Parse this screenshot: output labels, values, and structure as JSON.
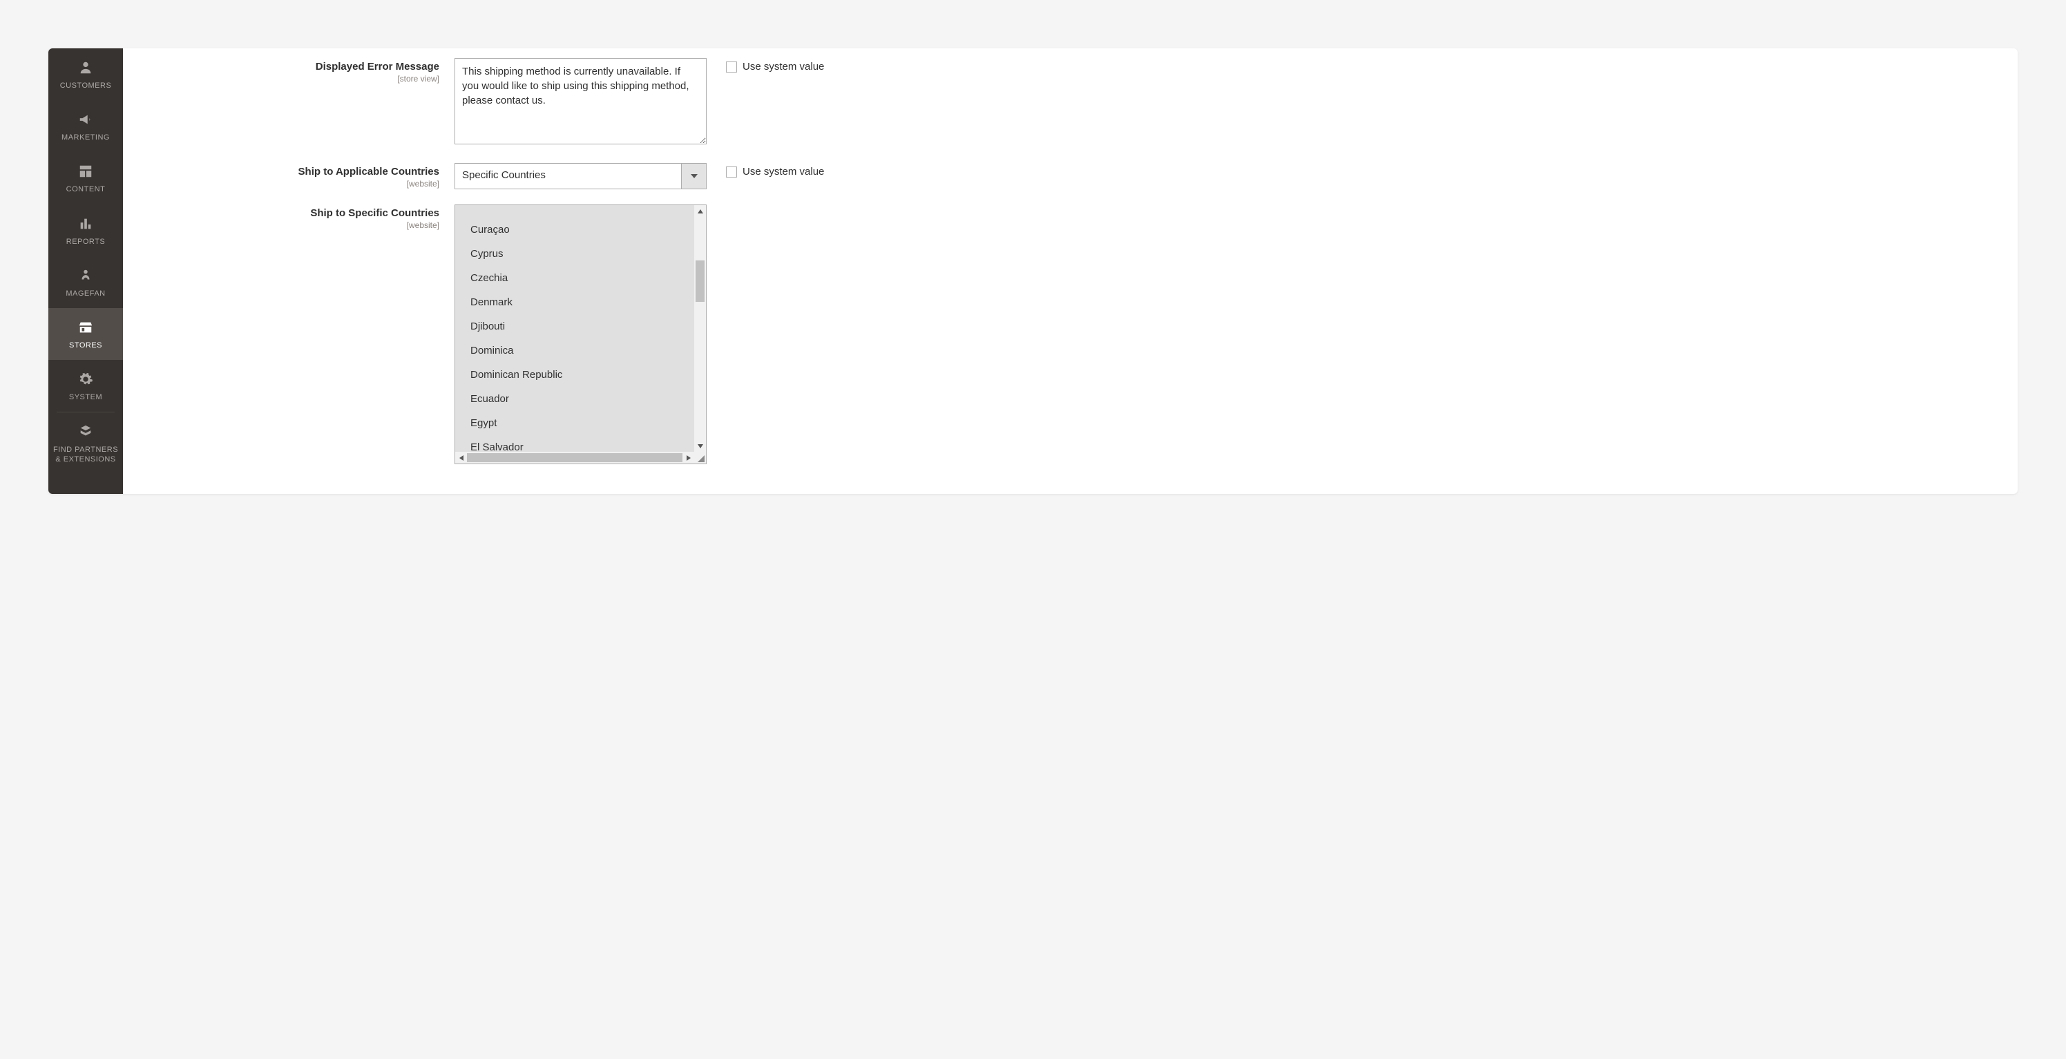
{
  "sidebar": {
    "items": [
      {
        "label": "CUSTOMERS"
      },
      {
        "label": "MARKETING"
      },
      {
        "label": "CONTENT"
      },
      {
        "label": "REPORTS"
      },
      {
        "label": "MAGEFAN"
      },
      {
        "label": "STORES"
      },
      {
        "label": "SYSTEM"
      },
      {
        "label": "FIND PARTNERS\n& EXTENSIONS"
      }
    ]
  },
  "fields": {
    "errorMessage": {
      "label": "Displayed Error Message",
      "scope": "[store view]",
      "value": "This shipping method is currently unavailable. If you would like to ship using this shipping method, please contact us.",
      "useSystem": "Use system value"
    },
    "applicableCountries": {
      "label": "Ship to Applicable Countries",
      "scope": "[website]",
      "value": "Specific Countries",
      "useSystem": "Use system value"
    },
    "specificCountries": {
      "label": "Ship to Specific Countries",
      "scope": "[website]",
      "options": [
        "Curaçao",
        "Cyprus",
        "Czechia",
        "Denmark",
        "Djibouti",
        "Dominica",
        "Dominican Republic",
        "Ecuador",
        "Egypt",
        "El Salvador"
      ]
    }
  }
}
